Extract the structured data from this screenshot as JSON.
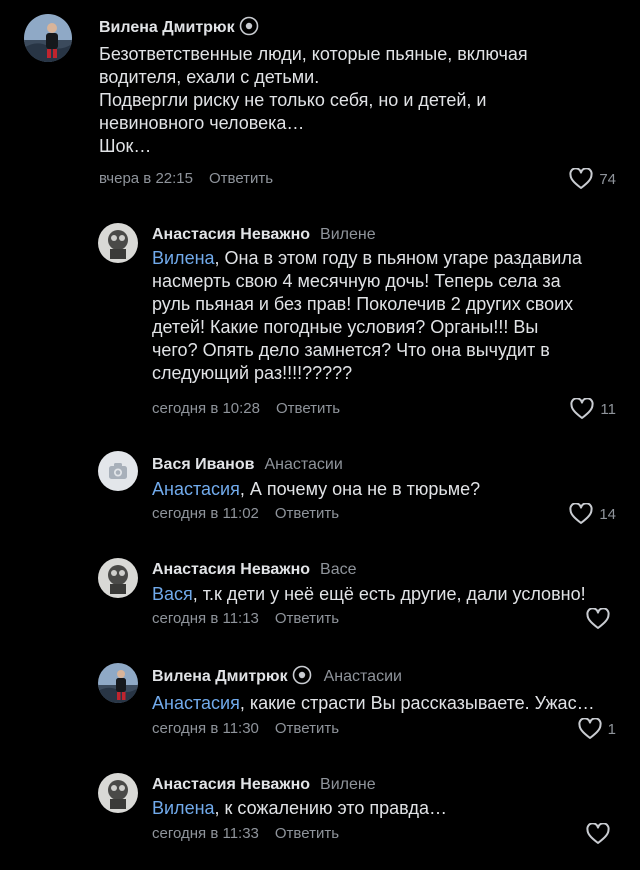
{
  "comments": [
    {
      "author": "Вилена Дмитрюк",
      "reply_to": "",
      "lines": [
        "Безответственные люди, которые пьяные, включая",
        "водителя, ехали с детьми.",
        "Подвергли риску не только себя, но и детей, и",
        "невиновного человека…",
        "Шок…"
      ],
      "time": "вчера в 22:15",
      "reply_label": "Ответить",
      "likes": "74"
    },
    {
      "author": "Анастасия Неважно",
      "reply_to": "Вилене",
      "mention": "Вилена",
      "text_first": ", Она в этом году в пьяном угаре раздавила",
      "lines": [
        "насмерть свою 4 месячную дочь! Теперь села за",
        "руль пьяная и без прав! Поколечив 2 других своих",
        "детей! Какие погодные условия? Органы!!! Вы",
        "чего? Опять дело замнется? Что она вычудит в",
        "следующий раз!!!!?????"
      ],
      "time": "сегодня в 10:28",
      "reply_label": "Ответить",
      "likes": "11"
    },
    {
      "author": "Вася Иванов",
      "reply_to": "Анастасии",
      "mention": "Анастасия",
      "text_first": ", А почему она не в тюрьме?",
      "time": "сегодня в 11:02",
      "reply_label": "Ответить",
      "likes": "14"
    },
    {
      "author": "Анастасия Неважно",
      "reply_to": "Васе",
      "mention": "Вася",
      "text_first": ", т.к дети у неё ещё есть другие, дали условно!",
      "time": "сегодня в 11:13",
      "reply_label": "Ответить",
      "likes": ""
    },
    {
      "author": "Вилена Дмитрюк",
      "reply_to": "Анастасии",
      "mention": "Анастасия",
      "text_first": ", какие страсти Вы рассказываете. Ужас…",
      "time": "сегодня в 11:30",
      "reply_label": "Ответить",
      "likes": "1"
    },
    {
      "author": "Анастасия Неважно",
      "reply_to": "Вилене",
      "mention": "Вилена",
      "text_first": ", к сожалению это правда…",
      "time": "сегодня в 11:33",
      "reply_label": "Ответить",
      "likes": ""
    }
  ],
  "colors": {
    "background": "#000000",
    "text": "#e1e3e6",
    "secondary": "#8f949b",
    "mention": "#71aaeb"
  }
}
